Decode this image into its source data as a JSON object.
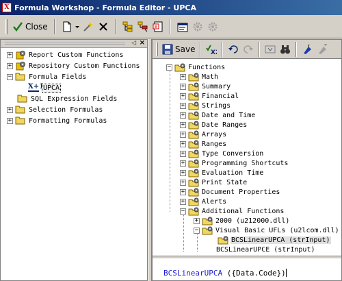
{
  "window": {
    "title": "Formula Workshop - Formula Editor - UPCA",
    "icon_letter": "X"
  },
  "toolbar": {
    "close_label": "Close"
  },
  "left_tree": {
    "items": [
      {
        "label": "Report Custom Functions",
        "type": "gear",
        "expander": "+"
      },
      {
        "label": "Repository Custom Functions",
        "type": "gear",
        "expander": "+"
      },
      {
        "label": "Formula Fields",
        "type": "folder-open",
        "expander": "−"
      },
      {
        "label": "UPCA",
        "type": "formula",
        "expander": "",
        "selected": true
      },
      {
        "label": "SQL Expression Fields",
        "type": "folder",
        "expander": ""
      },
      {
        "label": "Selection Formulas",
        "type": "folder",
        "expander": "+"
      },
      {
        "label": "Formatting Formulas",
        "type": "folder",
        "expander": "+"
      }
    ]
  },
  "editor": {
    "save_label": "Save",
    "functions_root": "Functions",
    "categories": [
      "Math",
      "Summary",
      "Financial",
      "Strings",
      "Date and Time",
      "Date Ranges",
      "Arrays",
      "Ranges",
      "Type Conversion",
      "Programming Shortcuts",
      "Evaluation Time",
      "Print State",
      "Document Properties",
      "Alerts",
      "Additional Functions"
    ],
    "additional": {
      "child1": "2000 (u212000.dll)",
      "child2": "Visual Basic UFLs (u2lcom.dll)",
      "leaf1": "BCSLinearUPCA (strInput)",
      "leaf2": "BCSLinearUPCE (strInput)"
    },
    "formula_keyword": "BCSLinearUPCA",
    "formula_args": " ({Data.Code})"
  }
}
